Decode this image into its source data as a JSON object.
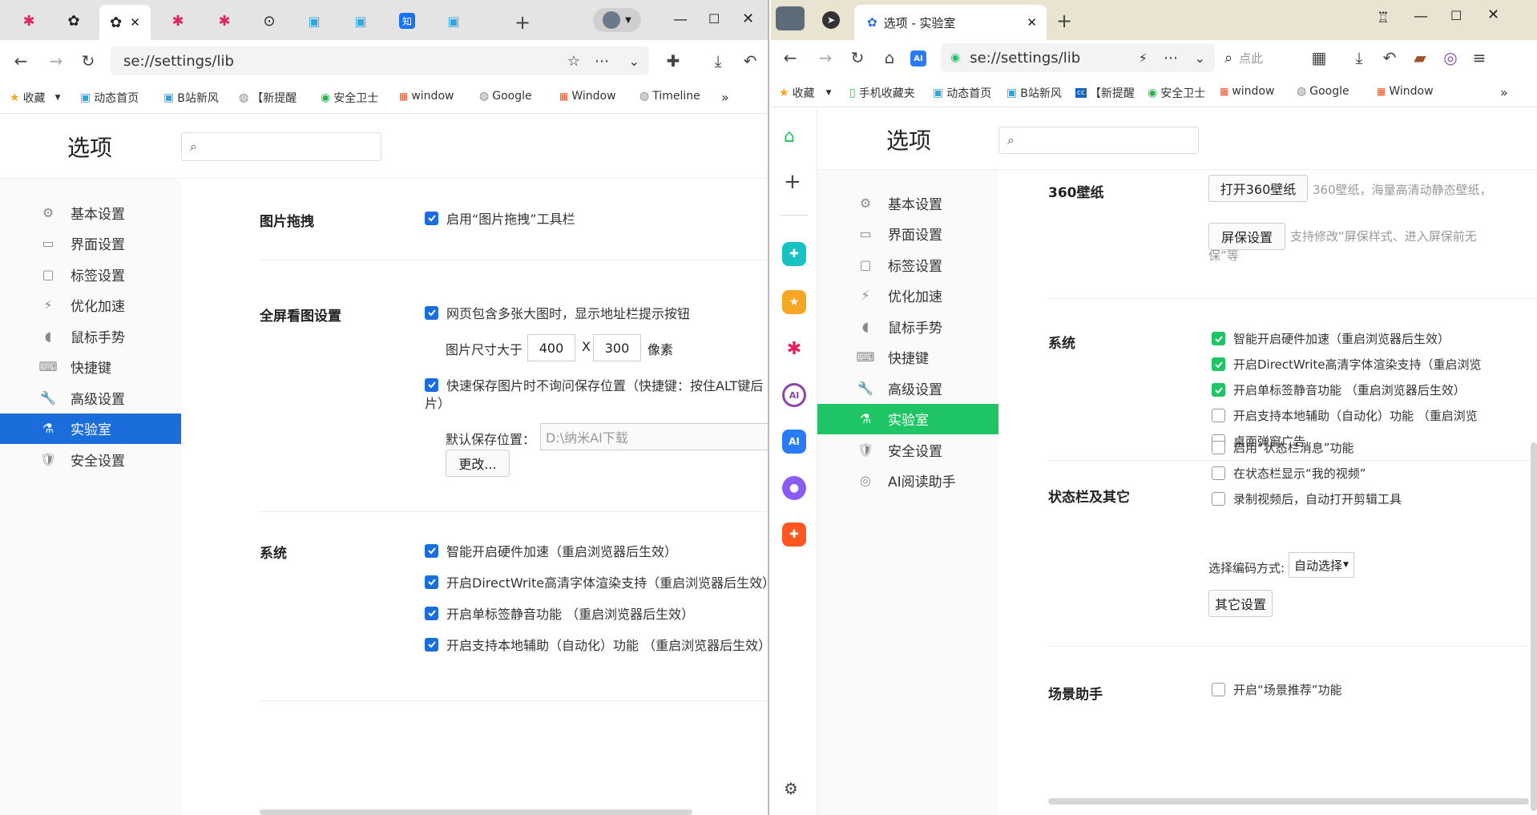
{
  "left": {
    "address": "se://settings/lib",
    "bookmarks": [
      "收藏",
      "动态首页",
      "B站新风",
      "【新提醒",
      "安全卫士",
      "window",
      "Google",
      "Window",
      "Timeline"
    ],
    "settings_title": "选项",
    "sidebar": [
      {
        "label": "基本设置"
      },
      {
        "label": "界面设置"
      },
      {
        "label": "标签设置"
      },
      {
        "label": "优化加速"
      },
      {
        "label": "鼠标手势"
      },
      {
        "label": "快捷键"
      },
      {
        "label": "高级设置"
      },
      {
        "label": "实验室"
      },
      {
        "label": "安全设置"
      }
    ],
    "sections": {
      "drag": {
        "title": "图片拖拽",
        "opt1": "启用“图片拖拽”工具栏"
      },
      "fullscreen": {
        "title": "全屏看图设置",
        "opt1": "网页包含多张大图时，显示地址栏提示按钮",
        "size_label": "图片尺寸大于",
        "width": "400",
        "x": "X",
        "height": "300",
        "unit": "像素",
        "opt2_line1": "快速保存图片时不询问保存位置（快捷键：按住ALT键后",
        "opt2_line2": "片）",
        "save_label": "默认保存位置：",
        "save_path": "D:\\纳米AI下载",
        "change_btn": "更改..."
      },
      "system": {
        "title": "系统",
        "opts": [
          "智能开启硬件加速（重启浏览器后生效）",
          "开启DirectWrite高清字体渲染支持（重启浏览器后生效）",
          "开启单标签静音功能 （重启浏览器后生效）",
          "开启支持本地辅助（自动化）功能 （重启浏览器后生效）"
        ]
      }
    }
  },
  "right": {
    "tab_title": "选项 - 实验室",
    "address": "se://settings/lib",
    "search_placeholder": "点此",
    "bookmarks": [
      "收藏",
      "手机收藏夹",
      "动态首页",
      "B站新风",
      "【新提醒",
      "安全卫士",
      "window",
      "Google",
      "Window"
    ],
    "settings_title": "选项",
    "sidebar": [
      {
        "label": "基本设置"
      },
      {
        "label": "界面设置"
      },
      {
        "label": "标签设置"
      },
      {
        "label": "优化加速"
      },
      {
        "label": "鼠标手势"
      },
      {
        "label": "快捷键"
      },
      {
        "label": "高级设置"
      },
      {
        "label": "实验室"
      },
      {
        "label": "安全设置"
      },
      {
        "label": "AI阅读助手"
      }
    ],
    "sections": {
      "wallpaper": {
        "title": "360壁纸",
        "btn1": "打开360壁纸",
        "desc1": "360壁纸，海量高清动静态壁纸，",
        "btn2": "屏保设置",
        "desc2_line1": "支持修改“屏保样式、进入屏保前无",
        "desc2_line2": "保”等"
      },
      "system": {
        "title": "系统",
        "opts": [
          {
            "label": "智能开启硬件加速（重启浏览器后生效）",
            "checked": true
          },
          {
            "label": "开启DirectWrite高清字体渲染支持（重启浏览",
            "checked": true
          },
          {
            "label": "开启单标签静音功能 （重启浏览器后生效）",
            "checked": true
          },
          {
            "label": "开启支持本地辅助（自动化）功能 （重启浏览",
            "checked": false
          },
          {
            "label": "桌面弹窗广告",
            "checked": false
          }
        ]
      },
      "statusbar": {
        "title": "状态栏及其它",
        "opts": [
          {
            "label": "启用“状态栏消息”功能",
            "checked": false
          },
          {
            "label": "在状态栏显示“我的视频”",
            "checked": false
          },
          {
            "label": "录制视频后，自动打开剪辑工具",
            "checked": false
          }
        ],
        "encode_label": "选择编码方式:",
        "encode_value": "自动选择",
        "other_btn": "其它设置"
      },
      "scene": {
        "title": "场景助手",
        "opt1": "开启“场景推荐”功能"
      }
    }
  }
}
